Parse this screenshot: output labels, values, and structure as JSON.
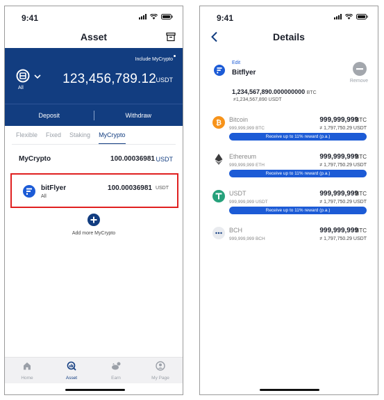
{
  "colors": {
    "brand": "#123d80",
    "accent": "#1c5bd6",
    "highlight": "#e02020"
  },
  "left": {
    "status_time": "9:41",
    "nav_title": "Asset",
    "include_label": "Include MyCrypto",
    "account_label": "All",
    "total_amount": "123,456,789.12",
    "total_unit": "USDT",
    "deposit": "Deposit",
    "withdraw": "Withdraw",
    "tabs": [
      "Flexible",
      "Fixed",
      "Staking",
      "MyCrypto"
    ],
    "active_tab": "MyCrypto",
    "section": {
      "label": "MyCrypto",
      "value": "100.00036981",
      "unit": "USDT"
    },
    "card": {
      "name": "bitFlyer",
      "sub": "All",
      "value": "100.00036981",
      "unit": "USDT"
    },
    "add_more": "Add more MyCrypto",
    "tabbar": [
      {
        "label": "Home",
        "icon": "home-icon",
        "active": false
      },
      {
        "label": "Asset",
        "icon": "asset-icon",
        "active": true
      },
      {
        "label": "Earn",
        "icon": "earn-icon",
        "active": false
      },
      {
        "label": "My Page",
        "icon": "profile-icon",
        "active": false
      }
    ]
  },
  "right": {
    "status_time": "9:41",
    "nav_title": "Details",
    "edit": "Edit",
    "exchange_name": "Bitflyer",
    "remove": "Remove",
    "total_amount": "1,234,567,890.000000000",
    "total_unit": "BTC",
    "total_approx": "≠1,234,567,890 USDT",
    "coins": [
      {
        "name": "Bitcoin",
        "sub": "999,999,999 BTC",
        "value": "999,999,999",
        "unit": "BTC",
        "approx": "≠ 1,797,750.29 USDT",
        "reward": "Receive up to 11% reward (p.a.)",
        "icon": "bitcoin-icon",
        "color": "#f7931a"
      },
      {
        "name": "Ethereum",
        "sub": "999,999,999 ETH",
        "value": "999,999,999",
        "unit": "BTC",
        "approx": "≠ 1,797,750.29 USDT",
        "reward": "Receive up to 11% reward (p.a.)",
        "icon": "ethereum-icon",
        "color": "#3c3c3d"
      },
      {
        "name": "USDT",
        "sub": "999,999,999 USDT",
        "value": "999,999,999",
        "unit": "BTC",
        "approx": "≠ 1,797,750.29 USDT",
        "reward": "Receive up to 11% reward (p.a.)",
        "icon": "tether-icon",
        "color": "#26a17b"
      },
      {
        "name": "BCH",
        "sub": "999,999,999 BCH",
        "value": "999,999,999",
        "unit": "BTC",
        "approx": "≠ 1,797,750.29 USDT",
        "reward": "",
        "icon": "bch-icon",
        "color": "#d8dbe2"
      }
    ]
  }
}
